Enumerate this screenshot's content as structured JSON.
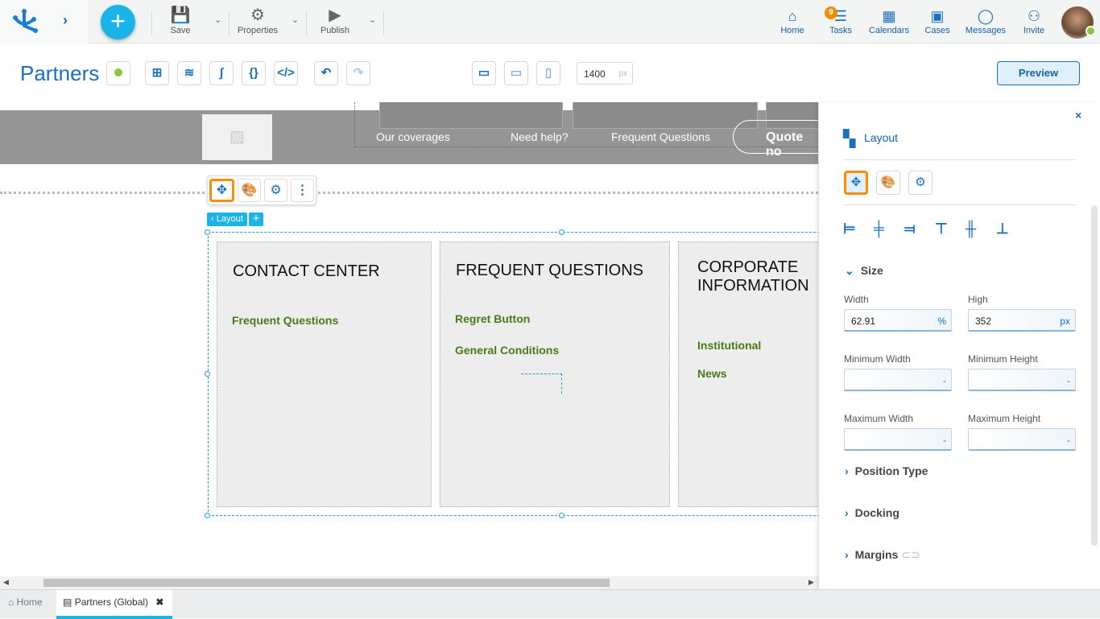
{
  "topbar": {
    "save": "Save",
    "properties": "Properties",
    "publish": "Publish",
    "nav": [
      {
        "label": "Home",
        "icon": "home-icon"
      },
      {
        "label": "Tasks",
        "icon": "tasks-icon",
        "badge": "9"
      },
      {
        "label": "Calendars",
        "icon": "calendar-icon"
      },
      {
        "label": "Cases",
        "icon": "briefcase-icon"
      },
      {
        "label": "Messages",
        "icon": "chat-icon"
      },
      {
        "label": "Invite",
        "icon": "invite-user-icon"
      }
    ]
  },
  "toolbar": {
    "title": "Partners",
    "width_value": "1400",
    "width_unit": "px",
    "preview": "Preview"
  },
  "canvas": {
    "menu": [
      "Our coverages",
      "Need help?",
      "Frequent Questions"
    ],
    "quote": "Quote no",
    "layout_tag": "Layout",
    "cards": [
      {
        "title": "CONTACT CENTER",
        "links": [
          "Frequent Questions"
        ]
      },
      {
        "title": "FREQUENT QUESTIONS",
        "links": [
          "Regret Button",
          "General Conditions"
        ]
      },
      {
        "title": "CORPORATE INFORMATION",
        "links": [
          "Institutional",
          "News"
        ]
      }
    ]
  },
  "panel": {
    "title": "Layout",
    "size": "Size",
    "width_label": "Width",
    "width_value": "62.91",
    "width_unit": "%",
    "high_label": "High",
    "high_value": "352",
    "high_unit": "px",
    "min_width": "Minimum Width",
    "min_height": "Minimum Height",
    "max_width": "Maximum Width",
    "max_height": "Maximum Height",
    "empty": "-",
    "position_type": "Position Type",
    "docking": "Docking",
    "margins": "Margins"
  },
  "tabs": {
    "home": "Home",
    "partners": "Partners (Global)"
  },
  "colors": {
    "accent": "#1a6fbf",
    "cyan": "#1ab4e8",
    "highlight": "#ff8c00",
    "status_green": "#8dc63f"
  }
}
